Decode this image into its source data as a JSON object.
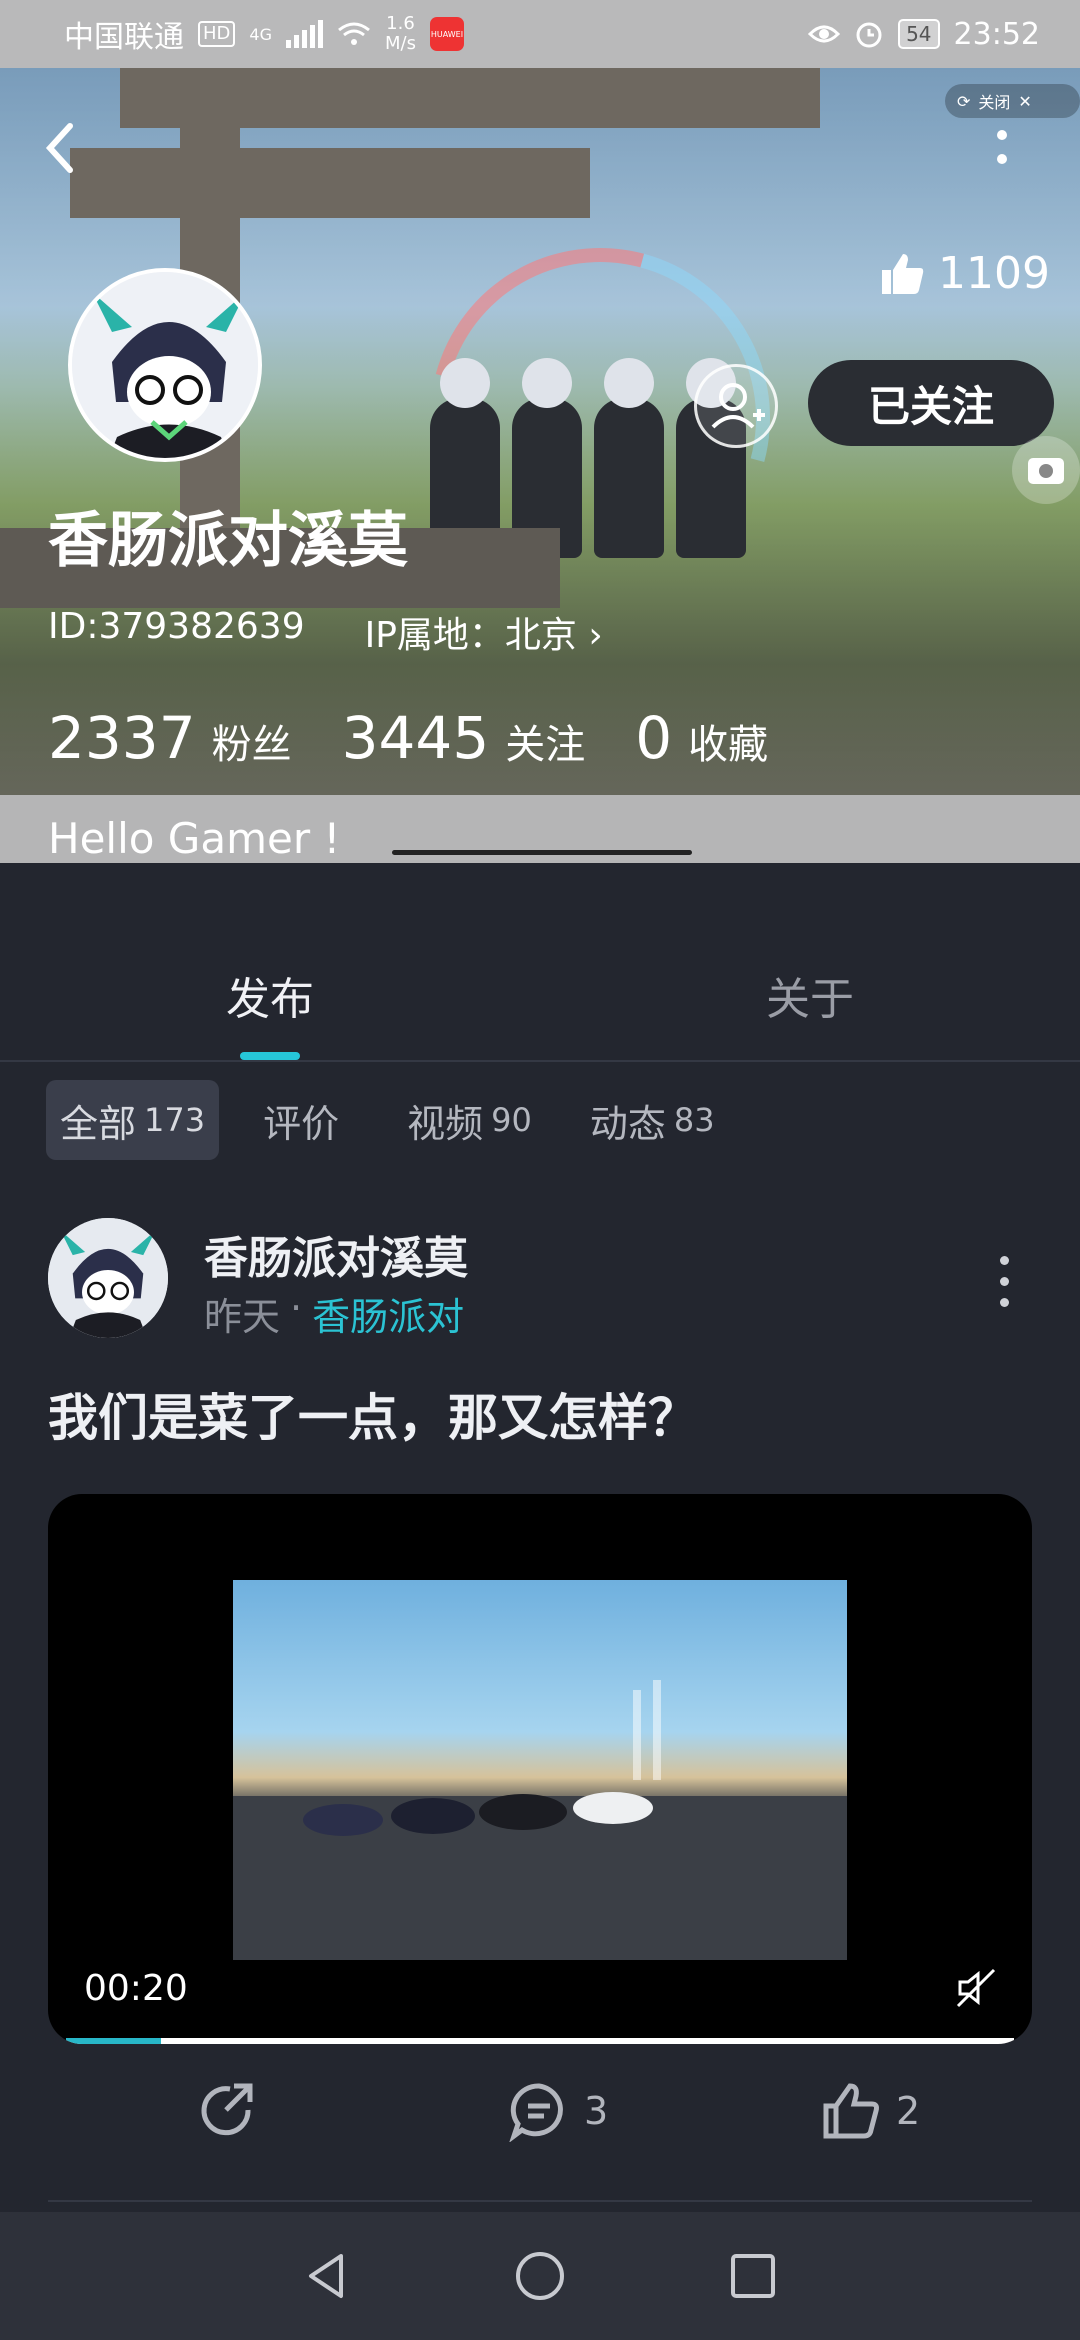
{
  "status_bar": {
    "carrier": "中国联通",
    "hd": "HD",
    "network": "4G",
    "speed_value": "1.6",
    "speed_unit": "M/s",
    "battery": "54",
    "time": "23:52"
  },
  "hero": {
    "close_label": "关闭",
    "like_count": "1109",
    "follow_label": "已关注",
    "username": "香肠派对溪莫",
    "user_id": "ID:379382639",
    "ip_location": "IP属地：北京",
    "stats": [
      {
        "value": "2337",
        "label": "粉丝"
      },
      {
        "value": "3445",
        "label": "关注"
      },
      {
        "value": "0",
        "label": "收藏"
      }
    ],
    "bio": "Hello Gamer !"
  },
  "tabs": [
    {
      "label": "发布",
      "active": true
    },
    {
      "label": "关于",
      "active": false
    }
  ],
  "filters": [
    {
      "label": "全部",
      "count": "173",
      "active": true
    },
    {
      "label": "评价",
      "count": "",
      "active": false
    },
    {
      "label": "视频",
      "count": "90",
      "active": false
    },
    {
      "label": "动态",
      "count": "83",
      "active": false
    }
  ],
  "post": {
    "author": "香肠派对溪莫",
    "time": "昨天",
    "separator": "·",
    "game": "香肠派对",
    "title": "我们是菜了一点，那又怎样？",
    "video_time": "00:20",
    "video_progress": 0.1,
    "comment_count": "3",
    "like_count": "2"
  },
  "colors": {
    "accent": "#26c6d9",
    "background": "#23262f"
  }
}
